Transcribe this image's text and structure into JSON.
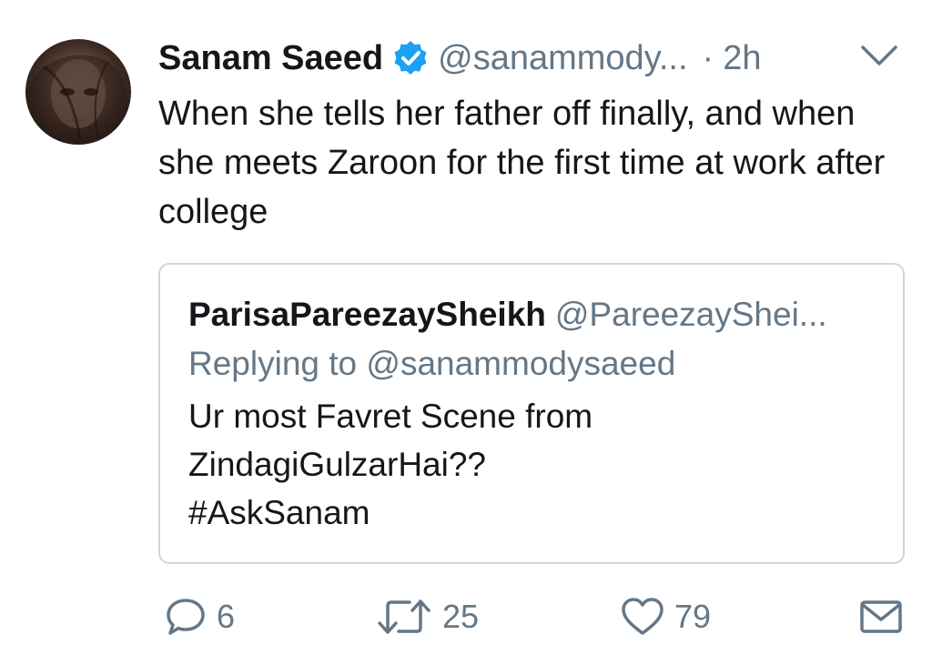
{
  "tweet": {
    "author_name": "Sanam Saeed",
    "handle": "@sanammody...",
    "separator": "·",
    "time": "2h",
    "text": "When she tells her father off finally, and when she meets Zaroon for the first time at work after college"
  },
  "quoted": {
    "author_name": "ParisaPareezaySheikh",
    "handle": "@PareezayShei...",
    "replying_to": "Replying to @sanammodysaeed",
    "text_line1": "Ur most Favret Scene from",
    "text_line2": "ZindagiGulzarHai??",
    "text_line3": "#AskSanam"
  },
  "actions": {
    "reply_count": "6",
    "retweet_count": "25",
    "like_count": "79"
  },
  "icons": {
    "verified": "verified-badge-icon",
    "more": "chevron-down-icon",
    "reply": "reply-bubble-icon",
    "retweet": "retweet-icon",
    "like": "heart-icon",
    "dm": "envelope-icon"
  },
  "colors": {
    "text": "#14171a",
    "secondary": "#657786",
    "verified_blue": "#1da1f2",
    "border": "#ccd6dd"
  }
}
